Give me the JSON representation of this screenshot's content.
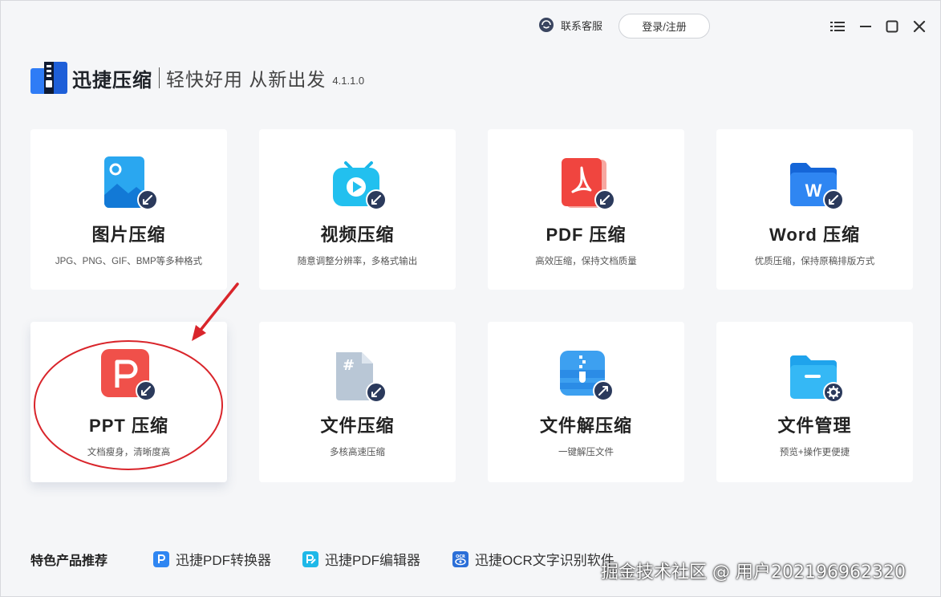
{
  "topbar": {
    "service_label": "联系客服",
    "login_label": "登录/注册"
  },
  "brand": {
    "name": "迅捷压缩",
    "slogan": "轻快好用 从新出发",
    "version": "4.1.1.0"
  },
  "cards": [
    {
      "title": "图片压缩",
      "desc": "JPG、PNG、GIF、BMP等多种格式",
      "icon": "image-compress-icon"
    },
    {
      "title": "视频压缩",
      "desc": "随意调整分辨率，多格式输出",
      "icon": "video-compress-icon"
    },
    {
      "title": "PDF 压缩",
      "desc": "高效压缩，保持文档质量",
      "icon": "pdf-compress-icon"
    },
    {
      "title": "Word 压缩",
      "desc": "优质压缩，保持原稿排版方式",
      "icon": "word-compress-icon"
    },
    {
      "title": "PPT 压缩",
      "desc": "文档瘦身，清晰度高",
      "icon": "ppt-compress-icon"
    },
    {
      "title": "文件压缩",
      "desc": "多核高速压缩",
      "icon": "file-compress-icon"
    },
    {
      "title": "文件解压缩",
      "desc": "一键解压文件",
      "icon": "file-decompress-icon"
    },
    {
      "title": "文件管理",
      "desc": "预览+操作更便捷",
      "icon": "file-manage-icon"
    }
  ],
  "footer": {
    "featured_label": "特色产品推荐",
    "products": [
      "迅捷PDF转换器",
      "迅捷PDF编辑器",
      "迅捷OCR文字识别软件"
    ]
  },
  "watermark": "掘金技术社区 @ 用户202196962320",
  "colors": {
    "accent": "#2f7cf6",
    "annotation_red": "#d9252b",
    "badge_dark": "#2b3a5c"
  }
}
